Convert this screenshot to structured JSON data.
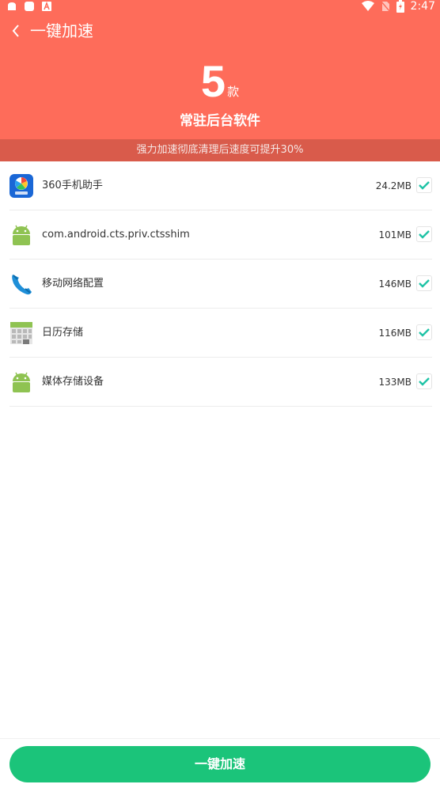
{
  "status_bar": {
    "time": "2:47"
  },
  "header": {
    "title": "一键加速",
    "count": "5",
    "count_unit": "款",
    "subtitle": "常驻后台软件",
    "background": "#fe6c5a"
  },
  "banner": {
    "text": "强力加速彻底清理后速度可提升30%"
  },
  "apps": [
    {
      "name": "360手机助手",
      "size": "24.2MB",
      "checked": true,
      "icon": "360-assistant-icon"
    },
    {
      "name": "com.android.cts.priv.ctsshim",
      "size": "101MB",
      "checked": true,
      "icon": "android-robot-icon"
    },
    {
      "name": "移动网络配置",
      "size": "146MB",
      "checked": true,
      "icon": "phone-handset-icon"
    },
    {
      "name": "日历存储",
      "size": "116MB",
      "checked": true,
      "icon": "calendar-storage-icon"
    },
    {
      "name": "媒体存储设备",
      "size": "133MB",
      "checked": true,
      "icon": "android-robot-icon"
    }
  ],
  "action": {
    "label": "一键加速",
    "color": "#1bc47a"
  }
}
